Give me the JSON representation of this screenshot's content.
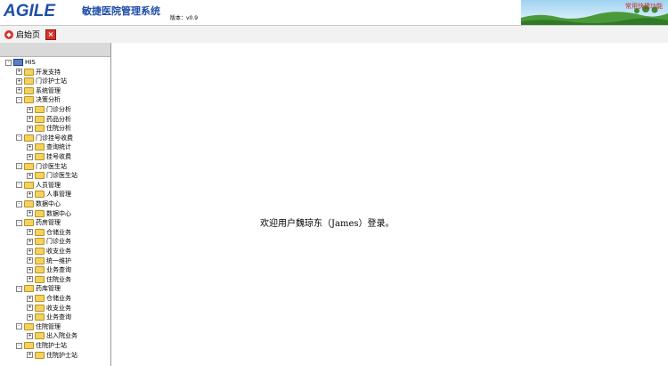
{
  "header": {
    "logo": "AGILE",
    "title": "敏捷医院管理系统",
    "version": "版本：v0.9",
    "scene_text": "常用快捷功能"
  },
  "tabs": [
    {
      "label": "启始页"
    }
  ],
  "tree": {
    "items": [
      {
        "label": "HIS",
        "level": 0,
        "toggle": "-",
        "root": true
      },
      {
        "label": "开发支持",
        "level": 1,
        "toggle": "+"
      },
      {
        "label": "门诊护士站",
        "level": 1,
        "toggle": "+"
      },
      {
        "label": "系统管理",
        "level": 1,
        "toggle": "+"
      },
      {
        "label": "决策分析",
        "level": 1,
        "toggle": "-"
      },
      {
        "label": "门诊分析",
        "level": 2,
        "toggle": "+"
      },
      {
        "label": "药品分析",
        "level": 2,
        "toggle": "+"
      },
      {
        "label": "住院分析",
        "level": 2,
        "toggle": "+"
      },
      {
        "label": "门诊挂号收费",
        "level": 1,
        "toggle": "-"
      },
      {
        "label": "查询统计",
        "level": 2,
        "toggle": "+"
      },
      {
        "label": "挂号收费",
        "level": 2,
        "toggle": "+"
      },
      {
        "label": "门诊医生站",
        "level": 1,
        "toggle": "-"
      },
      {
        "label": "门诊医生站",
        "level": 2,
        "toggle": "+"
      },
      {
        "label": "人员管理",
        "level": 1,
        "toggle": "-"
      },
      {
        "label": "人事管理",
        "level": 2,
        "toggle": "+"
      },
      {
        "label": "数据中心",
        "level": 1,
        "toggle": "-"
      },
      {
        "label": "数据中心",
        "level": 2,
        "toggle": "+"
      },
      {
        "label": "药房管理",
        "level": 1,
        "toggle": "-"
      },
      {
        "label": "仓储业务",
        "level": 2,
        "toggle": "+"
      },
      {
        "label": "门诊业务",
        "level": 2,
        "toggle": "+"
      },
      {
        "label": "收支业务",
        "level": 2,
        "toggle": "+"
      },
      {
        "label": "统一维护",
        "level": 2,
        "toggle": "+"
      },
      {
        "label": "业务查询",
        "level": 2,
        "toggle": "+"
      },
      {
        "label": "住院业务",
        "level": 2,
        "toggle": "+"
      },
      {
        "label": "药库管理",
        "level": 1,
        "toggle": "-"
      },
      {
        "label": "仓储业务",
        "level": 2,
        "toggle": "+"
      },
      {
        "label": "收支业务",
        "level": 2,
        "toggle": "+"
      },
      {
        "label": "业务查询",
        "level": 2,
        "toggle": "+"
      },
      {
        "label": "住院管理",
        "level": 1,
        "toggle": "-"
      },
      {
        "label": "出入院业务",
        "level": 2,
        "toggle": "+"
      },
      {
        "label": "住院护士站",
        "level": 1,
        "toggle": "-"
      },
      {
        "label": "住院护士站",
        "level": 2,
        "toggle": "+"
      }
    ]
  },
  "main": {
    "welcome": "欢迎用户魏琼东（James）登录。"
  },
  "colors": {
    "brand": "#1e4ea8",
    "close": "#d8322f",
    "folder": "#f4d25c"
  }
}
